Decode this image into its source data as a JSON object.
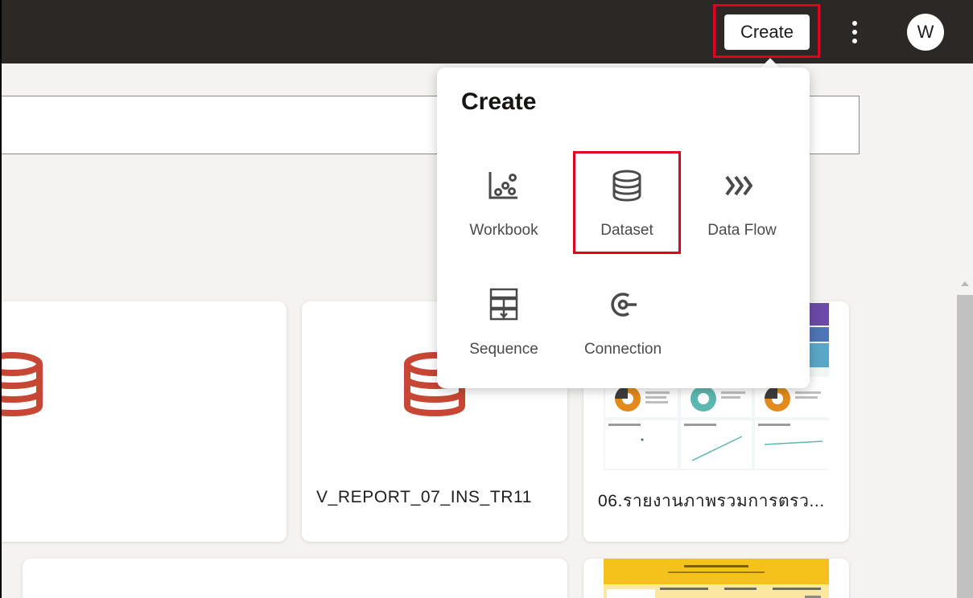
{
  "topbar": {
    "create_label": "Create",
    "avatar_initial": "W"
  },
  "cards": [
    {
      "title": ""
    },
    {
      "title": "V_REPORT_07_INS_TR11"
    },
    {
      "title": "06.รายงานภาพรวมการตรว..."
    }
  ],
  "popup": {
    "title": "Create",
    "items": [
      {
        "label": "Workbook",
        "icon": "workbook-icon"
      },
      {
        "label": "Dataset",
        "icon": "database-icon"
      },
      {
        "label": "Data Flow",
        "icon": "data-flow-icon"
      },
      {
        "label": "Sequence",
        "icon": "sequence-icon"
      },
      {
        "label": "Connection",
        "icon": "connection-icon"
      }
    ]
  },
  "colors": {
    "topbar": "#2b2825",
    "highlight": "#e3001b",
    "dataset_icon": "#c74634",
    "background": "#f4f3f1"
  }
}
